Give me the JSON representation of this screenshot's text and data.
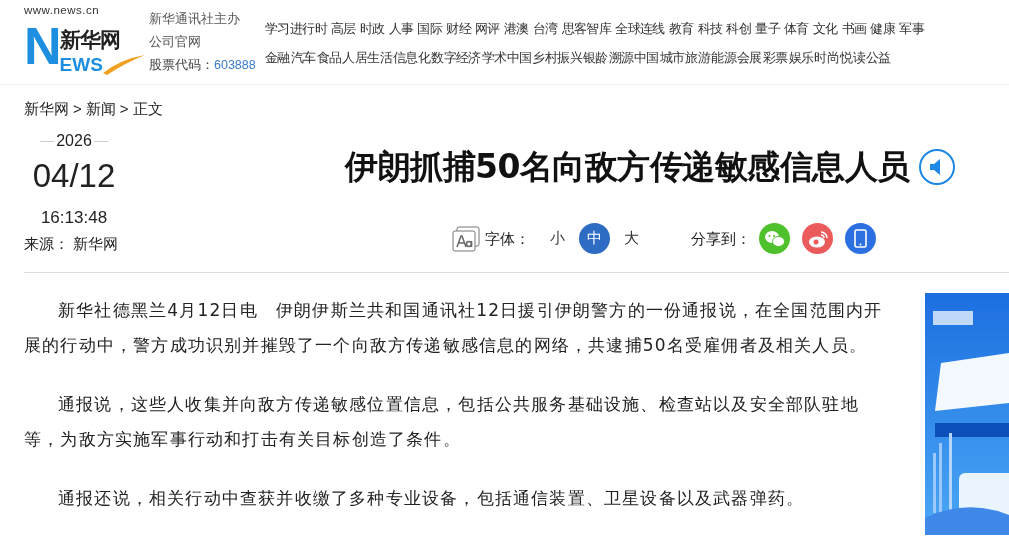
{
  "header": {
    "logo": {
      "url": "www.news.cn",
      "initial": "N",
      "name": "新华网",
      "rest": "EWS"
    },
    "company": {
      "line_1": "新华通讯社主办",
      "line_2": "公司官网",
      "stock_label": "股票代码：",
      "stock_code": "603888"
    },
    "nav_rows": [
      [
        "学习进行时",
        "高层",
        "时政",
        "人事",
        "国际",
        "财经",
        "网评",
        "港澳",
        "台湾",
        "思客智库",
        "全球连线",
        "教育",
        "科技",
        "科创",
        "量子",
        "体育",
        "文化",
        "书画",
        "健康",
        "军事"
      ],
      [
        "金融",
        "汽车",
        "食品",
        "人居生活",
        "信息化",
        "数字经济",
        "学术中国",
        "乡村振兴",
        "银龄",
        "溯源中国",
        "城市",
        "旅游",
        "能源",
        "会展",
        "彩票",
        "娱乐",
        "时尚",
        "悦读",
        "公益"
      ]
    ]
  },
  "breadcrumb": [
    {
      "kind": "link",
      "text": "新华网"
    },
    {
      "kind": "separator",
      "text": ">"
    },
    {
      "kind": "link",
      "text": "新闻"
    },
    {
      "kind": "separator",
      "text": ">"
    },
    {
      "kind": "current",
      "text": "正文"
    }
  ],
  "article": {
    "year": "2026",
    "date": "04/12",
    "time": "16:13:48",
    "source_label": "来源：",
    "source": "新华网",
    "title": "伊朗抓捕50名向敌方传递敏感信息人员",
    "font_label": "字体：",
    "font_sizes": [
      {
        "label": "小",
        "selected": false
      },
      {
        "label": "中",
        "selected": true
      },
      {
        "label": "大",
        "selected": false
      }
    ],
    "share_label": "分享到：",
    "share": [
      {
        "kind": "wechat"
      },
      {
        "kind": "weibo"
      },
      {
        "kind": "mobile"
      }
    ],
    "paragraphs": [
      "新华社德黑兰4月12日电　伊朗伊斯兰共和国通讯社12日援引伊朗警方的一份通报说，在全国范围内开展的行动中，警方成功识别并摧毁了一个向敌方传递敏感信息的网络，共逮捕50名受雇佣者及相关人员。",
      "通报说，这些人收集并向敌方传递敏感位置信息，包括公共服务基础设施、检查站以及安全部队驻地等，为敌方实施军事行动和打击有关目标创造了条件。",
      "通报还说，相关行动中查获并收缴了多种专业设备，包括通信装置、卫星设备以及武器弹药。"
    ]
  }
}
